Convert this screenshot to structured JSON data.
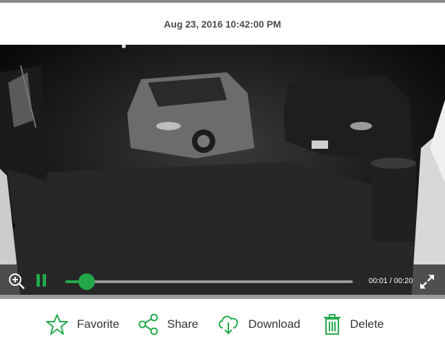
{
  "header": {
    "timestamp": "Aug 23, 2016 10:42:00 PM"
  },
  "player": {
    "state": "playing",
    "progress_fraction": 0.075,
    "time_display": "00:01 / 00:20",
    "accent_color": "#22a84a",
    "icons": {
      "zoom": "zoom-in-icon",
      "pause": "pause-icon",
      "fullscreen": "fullscreen-icon"
    }
  },
  "actions": [
    {
      "label": "Favorite",
      "icon": "star-icon"
    },
    {
      "label": "Share",
      "icon": "share-icon"
    },
    {
      "label": "Download",
      "icon": "cloud-download-icon"
    },
    {
      "label": "Delete",
      "icon": "trash-icon"
    }
  ],
  "colors": {
    "accent": "#22a84a",
    "text": "#333333",
    "timestamp": "#4a4a4a"
  }
}
